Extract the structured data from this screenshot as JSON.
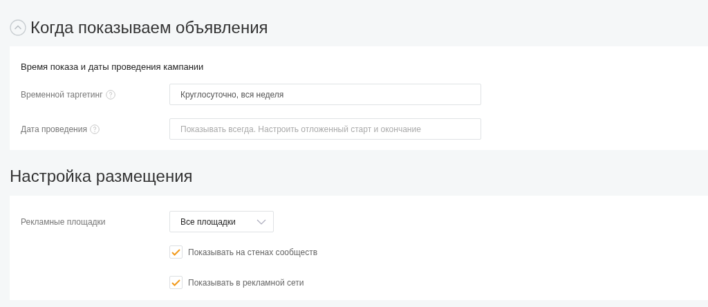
{
  "sections": [
    {
      "title": "Когда показываем объявления",
      "collapsible": true,
      "subtitle": "Время показа и даты проведения кампании",
      "rows": [
        {
          "kind": "input",
          "label": "Временной таргетинг",
          "help": true,
          "value": "Круглосуточно, вся неделя"
        },
        {
          "kind": "input",
          "label": "Дата проведения",
          "help": true,
          "placeholder": "Показывать всегда. Настроить отложенный старт и окончание"
        }
      ]
    },
    {
      "title": "Настройка размещения",
      "collapsible": false,
      "rows": [
        {
          "kind": "select",
          "label": "Рекламные площадки",
          "help": false,
          "value": "Все площадки"
        },
        {
          "kind": "checkbox",
          "label": "Показывать на стенах сообществ",
          "checked": true
        },
        {
          "kind": "checkbox",
          "label": "Показывать в рекламной сети",
          "checked": true
        }
      ]
    }
  ]
}
